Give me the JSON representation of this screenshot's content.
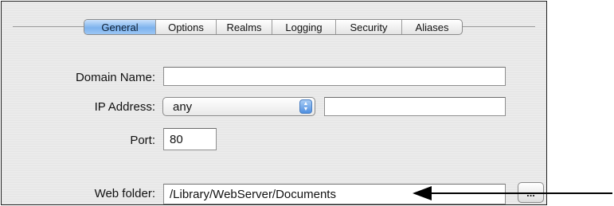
{
  "tabs": [
    {
      "label": "General",
      "active": true
    },
    {
      "label": "Options",
      "active": false
    },
    {
      "label": "Realms",
      "active": false
    },
    {
      "label": "Logging",
      "active": false
    },
    {
      "label": "Security",
      "active": false
    },
    {
      "label": "Aliases",
      "active": false
    }
  ],
  "form": {
    "domain_name": {
      "label": "Domain Name:",
      "value": ""
    },
    "ip_address": {
      "label": "IP Address:",
      "selected": "any",
      "value": ""
    },
    "port": {
      "label": "Port:",
      "value": "80"
    },
    "web_folder": {
      "label": "Web folder:",
      "value": "/Library/WebServer/Documents",
      "browse_label": "..."
    }
  },
  "icons": {
    "popup_arrows": "up-down-chevrons-icon",
    "annotation": "left-arrow-icon"
  },
  "colors": {
    "active_tab": "#7db3ee",
    "popup_accent": "#4f8fe0"
  }
}
